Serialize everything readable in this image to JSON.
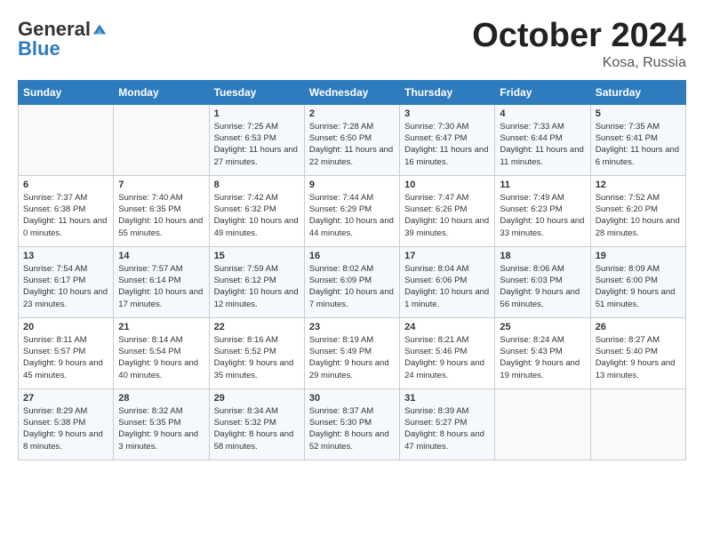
{
  "logo": {
    "general": "General",
    "blue": "Blue"
  },
  "title": {
    "month": "October 2024",
    "location": "Kosa, Russia"
  },
  "headers": [
    "Sunday",
    "Monday",
    "Tuesday",
    "Wednesday",
    "Thursday",
    "Friday",
    "Saturday"
  ],
  "weeks": [
    [
      {
        "day": "",
        "sunrise": "",
        "sunset": "",
        "daylight": ""
      },
      {
        "day": "",
        "sunrise": "",
        "sunset": "",
        "daylight": ""
      },
      {
        "day": "1",
        "sunrise": "Sunrise: 7:25 AM",
        "sunset": "Sunset: 6:53 PM",
        "daylight": "Daylight: 11 hours and 27 minutes."
      },
      {
        "day": "2",
        "sunrise": "Sunrise: 7:28 AM",
        "sunset": "Sunset: 6:50 PM",
        "daylight": "Daylight: 11 hours and 22 minutes."
      },
      {
        "day": "3",
        "sunrise": "Sunrise: 7:30 AM",
        "sunset": "Sunset: 6:47 PM",
        "daylight": "Daylight: 11 hours and 16 minutes."
      },
      {
        "day": "4",
        "sunrise": "Sunrise: 7:33 AM",
        "sunset": "Sunset: 6:44 PM",
        "daylight": "Daylight: 11 hours and 11 minutes."
      },
      {
        "day": "5",
        "sunrise": "Sunrise: 7:35 AM",
        "sunset": "Sunset: 6:41 PM",
        "daylight": "Daylight: 11 hours and 6 minutes."
      }
    ],
    [
      {
        "day": "6",
        "sunrise": "Sunrise: 7:37 AM",
        "sunset": "Sunset: 6:38 PM",
        "daylight": "Daylight: 11 hours and 0 minutes."
      },
      {
        "day": "7",
        "sunrise": "Sunrise: 7:40 AM",
        "sunset": "Sunset: 6:35 PM",
        "daylight": "Daylight: 10 hours and 55 minutes."
      },
      {
        "day": "8",
        "sunrise": "Sunrise: 7:42 AM",
        "sunset": "Sunset: 6:32 PM",
        "daylight": "Daylight: 10 hours and 49 minutes."
      },
      {
        "day": "9",
        "sunrise": "Sunrise: 7:44 AM",
        "sunset": "Sunset: 6:29 PM",
        "daylight": "Daylight: 10 hours and 44 minutes."
      },
      {
        "day": "10",
        "sunrise": "Sunrise: 7:47 AM",
        "sunset": "Sunset: 6:26 PM",
        "daylight": "Daylight: 10 hours and 39 minutes."
      },
      {
        "day": "11",
        "sunrise": "Sunrise: 7:49 AM",
        "sunset": "Sunset: 6:23 PM",
        "daylight": "Daylight: 10 hours and 33 minutes."
      },
      {
        "day": "12",
        "sunrise": "Sunrise: 7:52 AM",
        "sunset": "Sunset: 6:20 PM",
        "daylight": "Daylight: 10 hours and 28 minutes."
      }
    ],
    [
      {
        "day": "13",
        "sunrise": "Sunrise: 7:54 AM",
        "sunset": "Sunset: 6:17 PM",
        "daylight": "Daylight: 10 hours and 23 minutes."
      },
      {
        "day": "14",
        "sunrise": "Sunrise: 7:57 AM",
        "sunset": "Sunset: 6:14 PM",
        "daylight": "Daylight: 10 hours and 17 minutes."
      },
      {
        "day": "15",
        "sunrise": "Sunrise: 7:59 AM",
        "sunset": "Sunset: 6:12 PM",
        "daylight": "Daylight: 10 hours and 12 minutes."
      },
      {
        "day": "16",
        "sunrise": "Sunrise: 8:02 AM",
        "sunset": "Sunset: 6:09 PM",
        "daylight": "Daylight: 10 hours and 7 minutes."
      },
      {
        "day": "17",
        "sunrise": "Sunrise: 8:04 AM",
        "sunset": "Sunset: 6:06 PM",
        "daylight": "Daylight: 10 hours and 1 minute."
      },
      {
        "day": "18",
        "sunrise": "Sunrise: 8:06 AM",
        "sunset": "Sunset: 6:03 PM",
        "daylight": "Daylight: 9 hours and 56 minutes."
      },
      {
        "day": "19",
        "sunrise": "Sunrise: 8:09 AM",
        "sunset": "Sunset: 6:00 PM",
        "daylight": "Daylight: 9 hours and 51 minutes."
      }
    ],
    [
      {
        "day": "20",
        "sunrise": "Sunrise: 8:11 AM",
        "sunset": "Sunset: 5:57 PM",
        "daylight": "Daylight: 9 hours and 45 minutes."
      },
      {
        "day": "21",
        "sunrise": "Sunrise: 8:14 AM",
        "sunset": "Sunset: 5:54 PM",
        "daylight": "Daylight: 9 hours and 40 minutes."
      },
      {
        "day": "22",
        "sunrise": "Sunrise: 8:16 AM",
        "sunset": "Sunset: 5:52 PM",
        "daylight": "Daylight: 9 hours and 35 minutes."
      },
      {
        "day": "23",
        "sunrise": "Sunrise: 8:19 AM",
        "sunset": "Sunset: 5:49 PM",
        "daylight": "Daylight: 9 hours and 29 minutes."
      },
      {
        "day": "24",
        "sunrise": "Sunrise: 8:21 AM",
        "sunset": "Sunset: 5:46 PM",
        "daylight": "Daylight: 9 hours and 24 minutes."
      },
      {
        "day": "25",
        "sunrise": "Sunrise: 8:24 AM",
        "sunset": "Sunset: 5:43 PM",
        "daylight": "Daylight: 9 hours and 19 minutes."
      },
      {
        "day": "26",
        "sunrise": "Sunrise: 8:27 AM",
        "sunset": "Sunset: 5:40 PM",
        "daylight": "Daylight: 9 hours and 13 minutes."
      }
    ],
    [
      {
        "day": "27",
        "sunrise": "Sunrise: 8:29 AM",
        "sunset": "Sunset: 5:38 PM",
        "daylight": "Daylight: 9 hours and 8 minutes."
      },
      {
        "day": "28",
        "sunrise": "Sunrise: 8:32 AM",
        "sunset": "Sunset: 5:35 PM",
        "daylight": "Daylight: 9 hours and 3 minutes."
      },
      {
        "day": "29",
        "sunrise": "Sunrise: 8:34 AM",
        "sunset": "Sunset: 5:32 PM",
        "daylight": "Daylight: 8 hours and 58 minutes."
      },
      {
        "day": "30",
        "sunrise": "Sunrise: 8:37 AM",
        "sunset": "Sunset: 5:30 PM",
        "daylight": "Daylight: 8 hours and 52 minutes."
      },
      {
        "day": "31",
        "sunrise": "Sunrise: 8:39 AM",
        "sunset": "Sunset: 5:27 PM",
        "daylight": "Daylight: 8 hours and 47 minutes."
      },
      {
        "day": "",
        "sunrise": "",
        "sunset": "",
        "daylight": ""
      },
      {
        "day": "",
        "sunrise": "",
        "sunset": "",
        "daylight": ""
      }
    ]
  ]
}
